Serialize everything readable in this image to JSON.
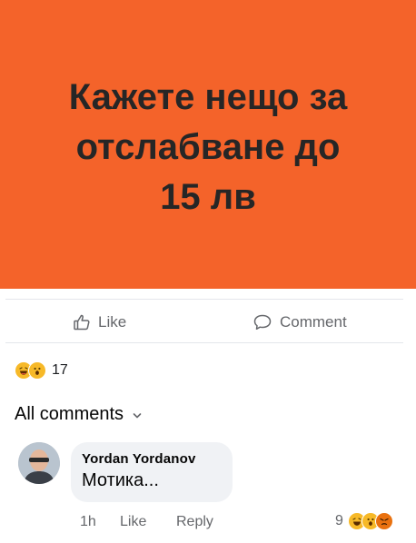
{
  "post": {
    "banner": {
      "lines": [
        "Кажете нещо за",
        "отслабване до",
        "15 лв"
      ],
      "background": "#f4632a",
      "text_color": "#262626"
    }
  },
  "actions": {
    "like_label": "Like",
    "like_icon": "thumbs-up-outline-icon",
    "comment_label": "Comment",
    "comment_icon": "speech-bubble-outline-icon"
  },
  "reactions": {
    "icons": [
      "haha-emoji-icon",
      "wow-emoji-icon"
    ],
    "count": "17"
  },
  "comments_section": {
    "filter_label": "All comments",
    "filter_icon": "chevron-down-icon"
  },
  "comment": {
    "author": "Yordan Yordanov",
    "text": "Мотика...",
    "time": "1h",
    "like_label": "Like",
    "reply_label": "Reply",
    "reaction_count": "9",
    "reaction_icons": [
      "haha-emoji-icon",
      "wow-emoji-icon",
      "angry-emoji-icon"
    ]
  }
}
